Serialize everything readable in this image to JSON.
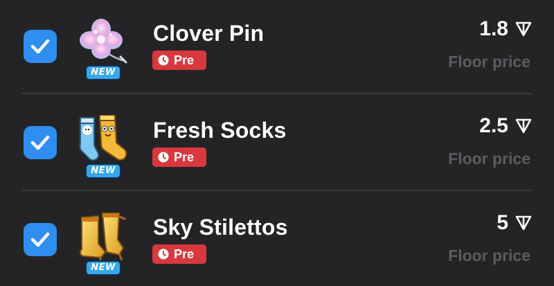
{
  "items": [
    {
      "name": "Clover Pin",
      "tag": "Pre",
      "badge": "NEW",
      "price": "1.8",
      "price_label": "Floor price",
      "checked": true,
      "icon": "clover-pin-icon"
    },
    {
      "name": "Fresh Socks",
      "tag": "Pre",
      "badge": "NEW",
      "price": "2.5",
      "price_label": "Floor price",
      "checked": true,
      "icon": "socks-icon"
    },
    {
      "name": "Sky Stilettos",
      "tag": "Pre",
      "badge": "NEW",
      "price": "5",
      "price_label": "Floor price",
      "checked": true,
      "icon": "stiletto-boots-icon"
    }
  ],
  "colors": {
    "background": "#242426",
    "checkbox": "#2f8ef0",
    "pre_badge": "#d9383e",
    "new_badge": "#37a8ea",
    "muted_text": "#5c5c60"
  },
  "currency_icon": "ton-icon"
}
